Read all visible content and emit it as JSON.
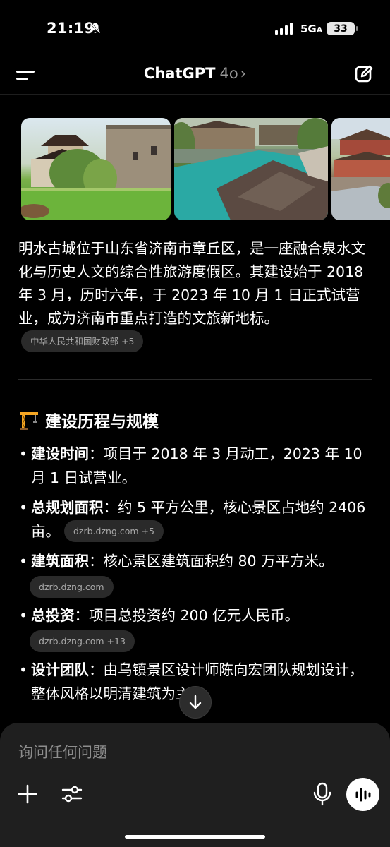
{
  "status_bar": {
    "time": "21:19",
    "network": "5G",
    "network_suffix": "A",
    "battery": "33"
  },
  "header": {
    "title": "ChatGPT",
    "model": "4o",
    "chevron": "›"
  },
  "images": [
    {
      "name": "ancient-city-wall-moat-image"
    },
    {
      "name": "canal-village-rooftops-image"
    },
    {
      "name": "pavilion-courtyard-image"
    }
  ],
  "intro": {
    "text": "明水古城位于山东省济南市章丘区，是一座融合泉水文化与历史人文的综合性旅游度假区。其建设始于 2018 年 3 月，历时六年，于 2023 年 10 月 1 日正式试营业，成为济南市重点打造的文旅新地标。",
    "source_chip": "中华人民共和国财政部 +5"
  },
  "section": {
    "icon": "construction-crane-icon",
    "title": "建设历程与规模"
  },
  "list": [
    {
      "label": "建设时间",
      "sep": "：",
      "text": "项目于 2018 年 3 月动工，2023 年 10 月 1 日试营业。",
      "chip": ""
    },
    {
      "label": "总规划面积",
      "sep": "：",
      "text": "约 5 平方公里，核心景区占地约 2406 亩。",
      "chip": "dzrb.dzng.com +5"
    },
    {
      "label": "建筑面积",
      "sep": "：",
      "text": "核心景区建筑面积约 80 万平方米。",
      "chip": "dzrb.dzng.com"
    },
    {
      "label": "总投资",
      "sep": "：",
      "text": "项目总投资约 200 亿元人民币。",
      "chip": "dzrb.dzng.com +13"
    },
    {
      "label": "设计团队",
      "sep": "：",
      "text": "由乌镇景区设计师陈向宏团队规划设计，整体风格以明清建筑为主。",
      "chip": ""
    }
  ],
  "composer": {
    "placeholder": "询问任何问题"
  }
}
